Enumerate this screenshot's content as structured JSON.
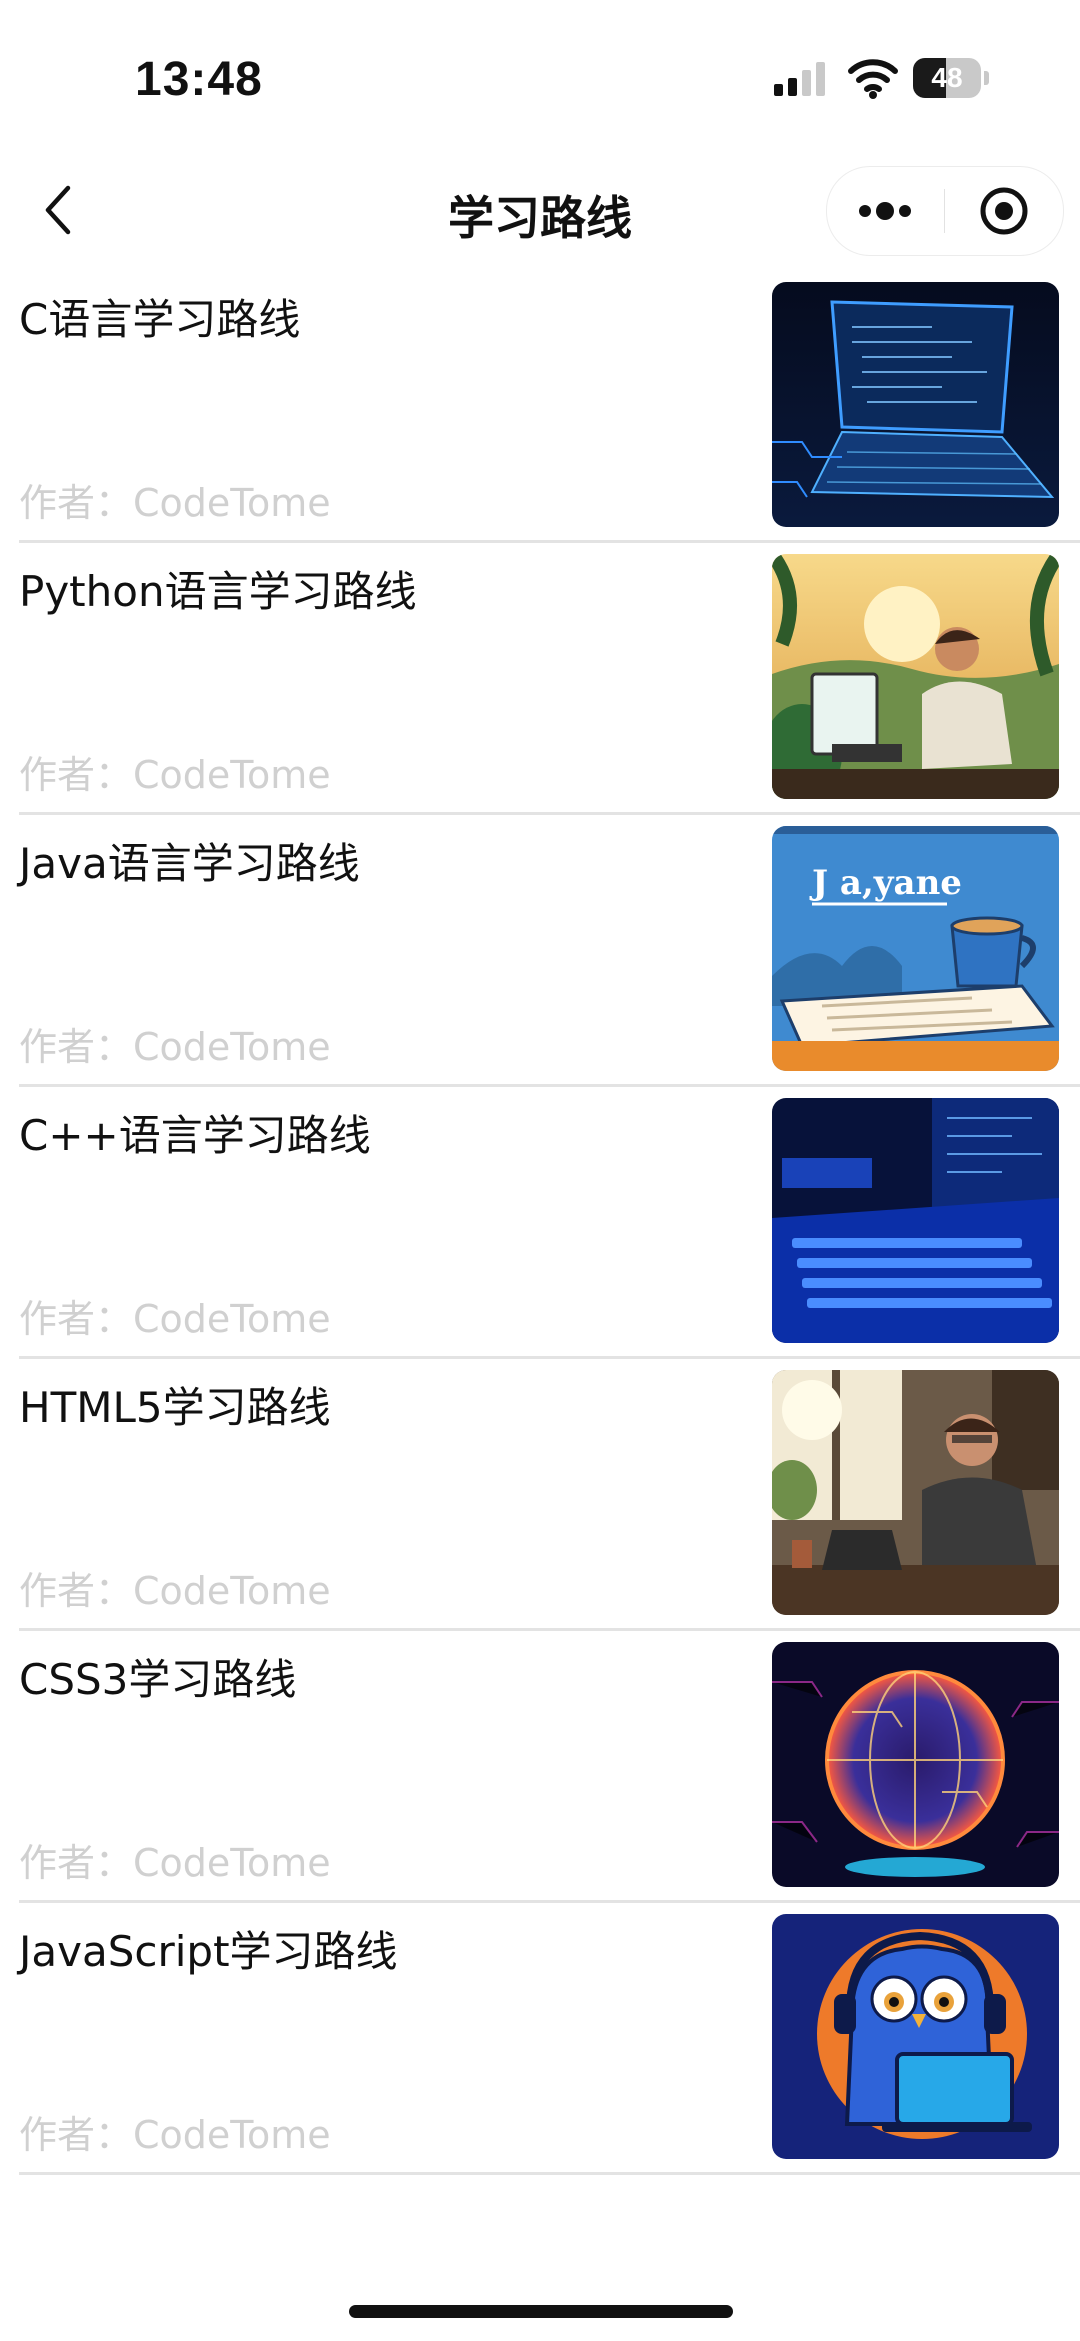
{
  "status_bar": {
    "time": "13:48",
    "battery_level": "48",
    "battery_fraction": 0.48
  },
  "nav": {
    "title": "学习路线",
    "back_icon": "chevron-left-icon",
    "more_icon": "more-dots-icon",
    "close_icon": "target-close-icon"
  },
  "items": [
    {
      "title": "C语言学习路线",
      "author": "作者：CodeTome",
      "thumb": "laptop-code-neon-image"
    },
    {
      "title": "Python语言学习路线",
      "author": "作者：CodeTome",
      "thumb": "programmer-jungle-image"
    },
    {
      "title": "Java语言学习路线",
      "author": "作者：CodeTome",
      "thumb": "java-coffee-image",
      "thumb_text": "J a,yane"
    },
    {
      "title": "C++语言学习路线",
      "author": "作者：CodeTome",
      "thumb": "blue-keyboard-image"
    },
    {
      "title": "HTML5学习路线",
      "author": "作者：CodeTome",
      "thumb": "developer-window-image"
    },
    {
      "title": "CSS3学习路线",
      "author": "作者：CodeTome",
      "thumb": "circuit-globe-image"
    },
    {
      "title": "JavaScript学习路线",
      "author": "作者：CodeTome",
      "thumb": "owl-laptop-image"
    }
  ]
}
